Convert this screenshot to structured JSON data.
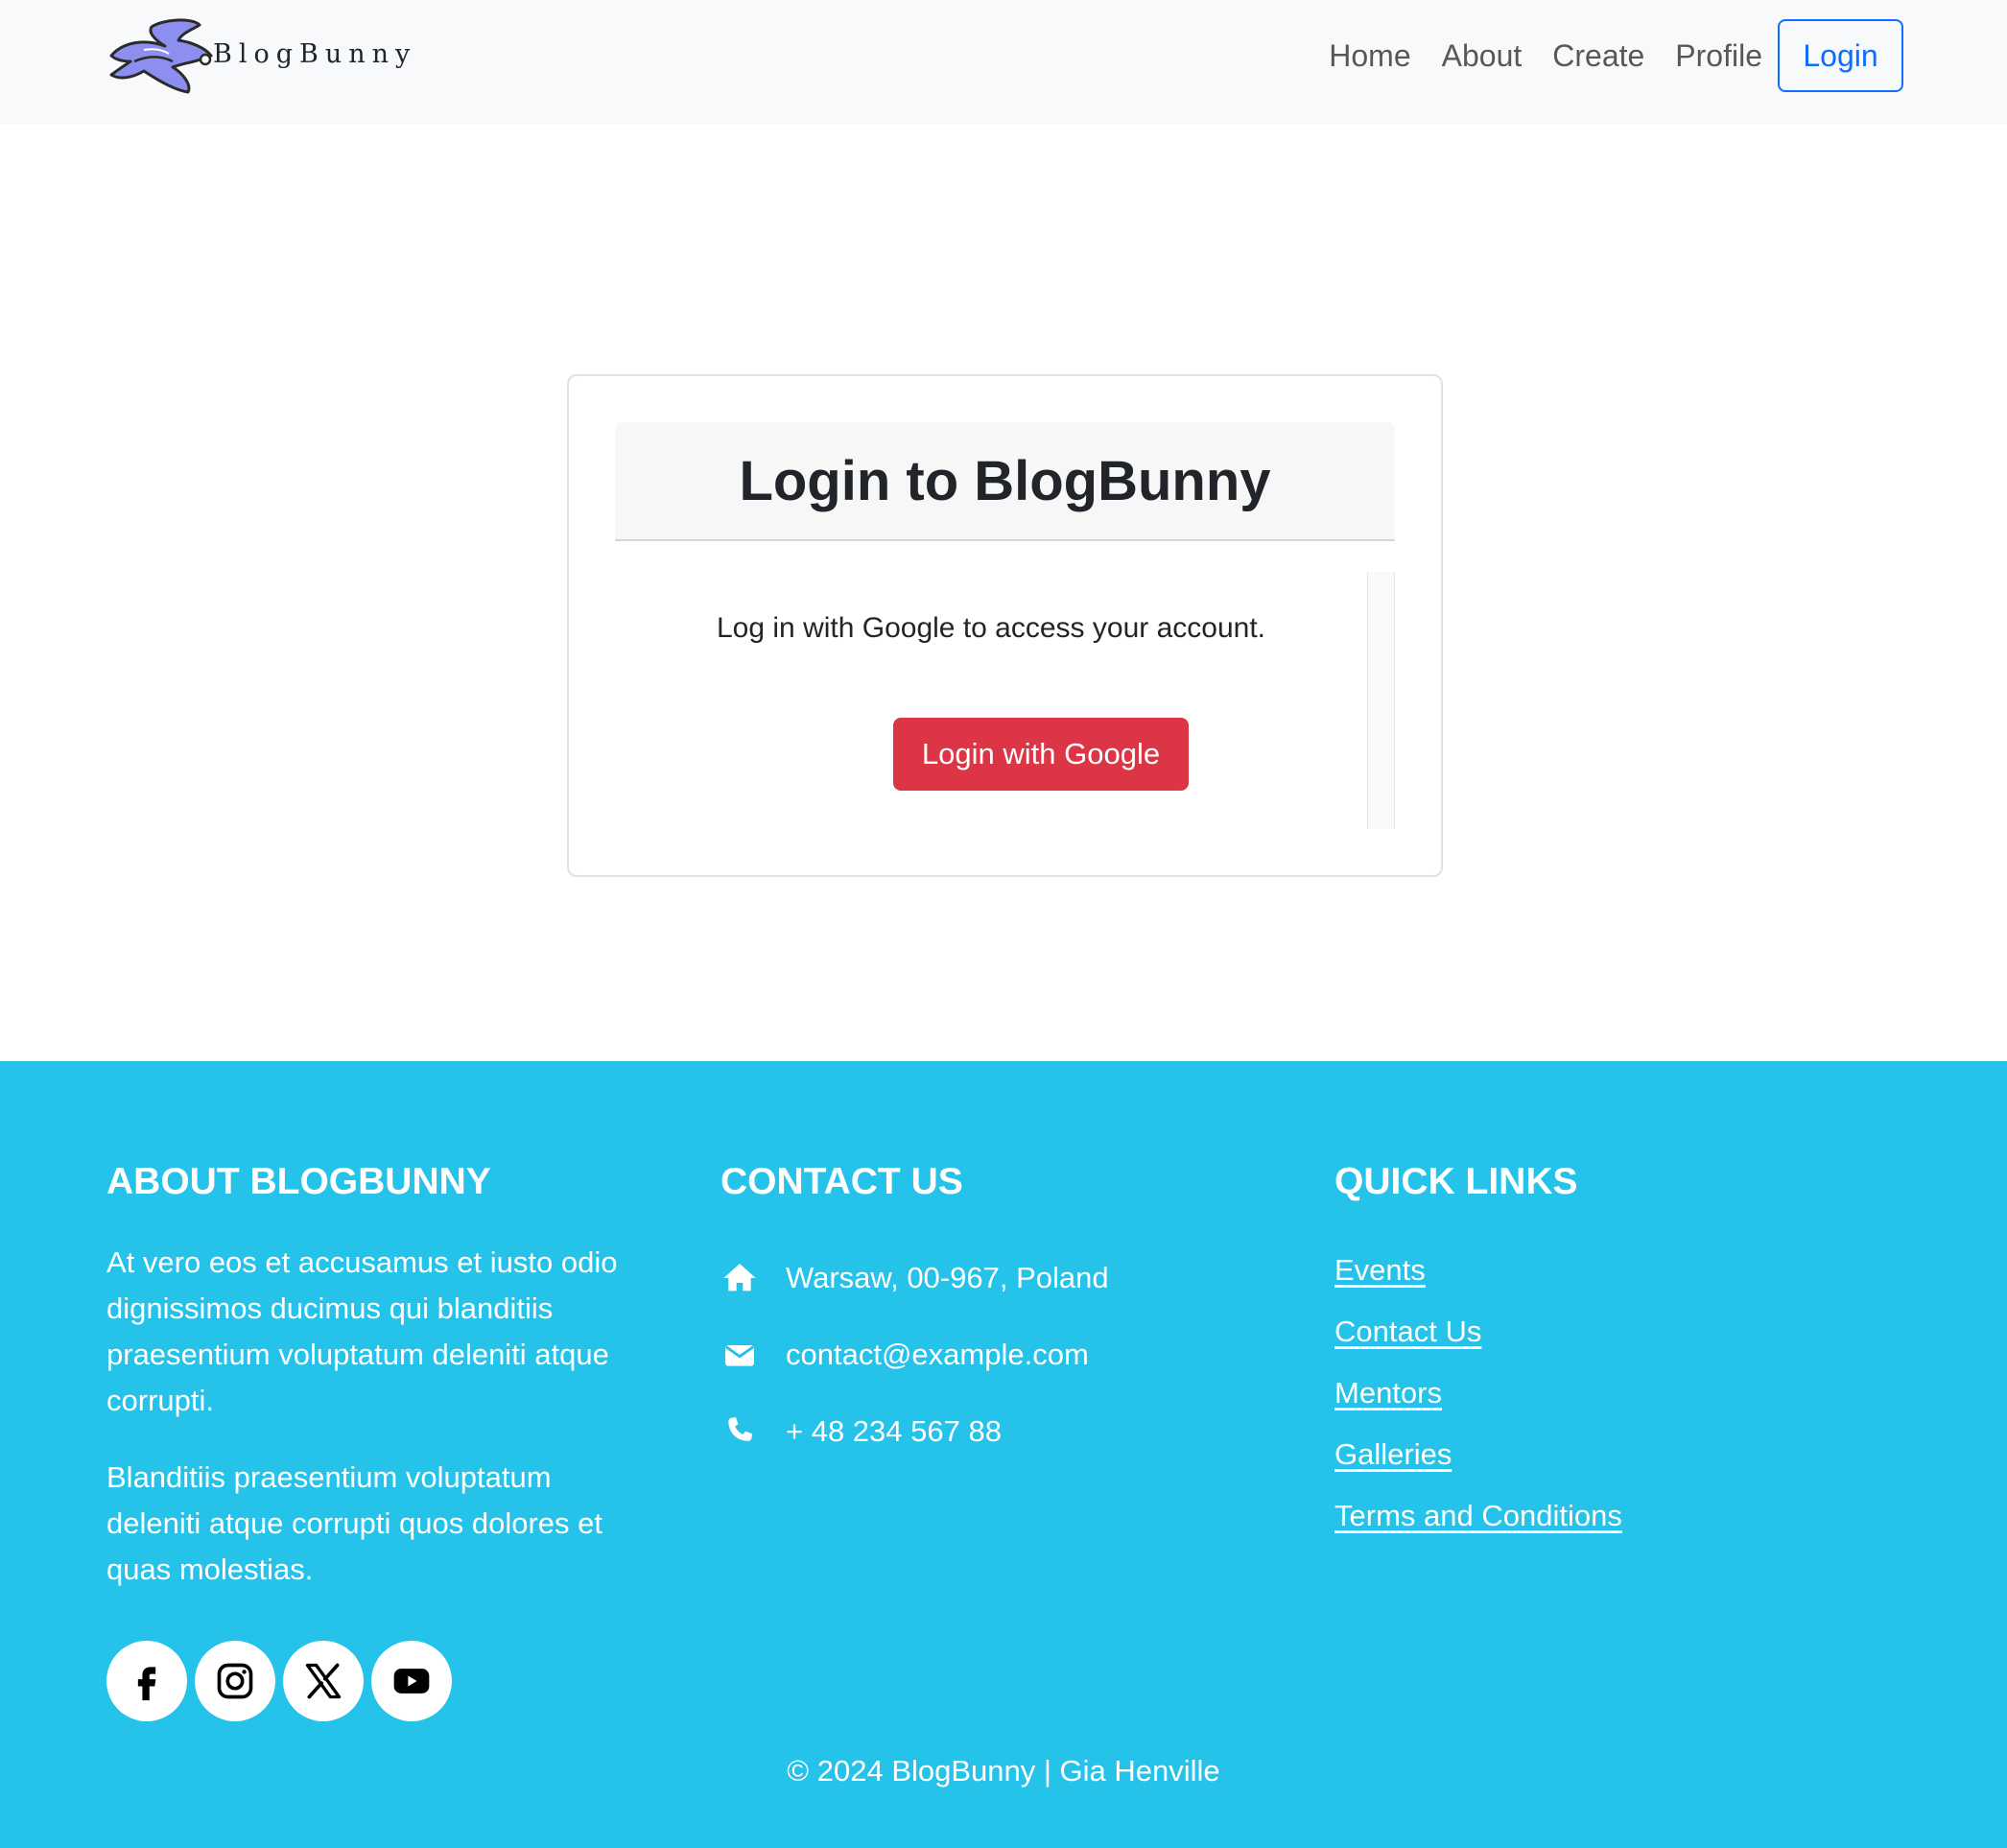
{
  "navbar": {
    "brand_name": "BlogBunny",
    "links": [
      "Home",
      "About",
      "Create",
      "Profile"
    ],
    "login_label": "Login"
  },
  "login_card": {
    "title": "Login to BlogBunny",
    "text": "Log in with Google to access your account.",
    "google_button": "Login with Google",
    "google_button_color": "#dc3545"
  },
  "footer": {
    "background": "#25c3e9",
    "about": {
      "title": "ABOUT BLOGBUNNY",
      "paragraphs": [
        "At vero eos et accusamus et iusto odio dignissimos ducimus qui blanditiis praesentium voluptatum deleniti atque corrupti.",
        "Blanditiis praesentium voluptatum deleniti atque corrupti quos dolores et quas molestias."
      ],
      "social_icons": [
        "facebook-icon",
        "instagram-icon",
        "x-icon",
        "youtube-icon"
      ]
    },
    "contact": {
      "title": "CONTACT US",
      "address": "Warsaw, 00-967, Poland",
      "email": "contact@example.com",
      "phone": "+ 48 234 567 88"
    },
    "quick_links": {
      "title": "QUICK LINKS",
      "items": [
        "Events",
        "Contact Us",
        "Mentors",
        "Galleries",
        "Terms and Conditions"
      ]
    },
    "copyright": "© 2024 BlogBunny | Gia Henville"
  }
}
